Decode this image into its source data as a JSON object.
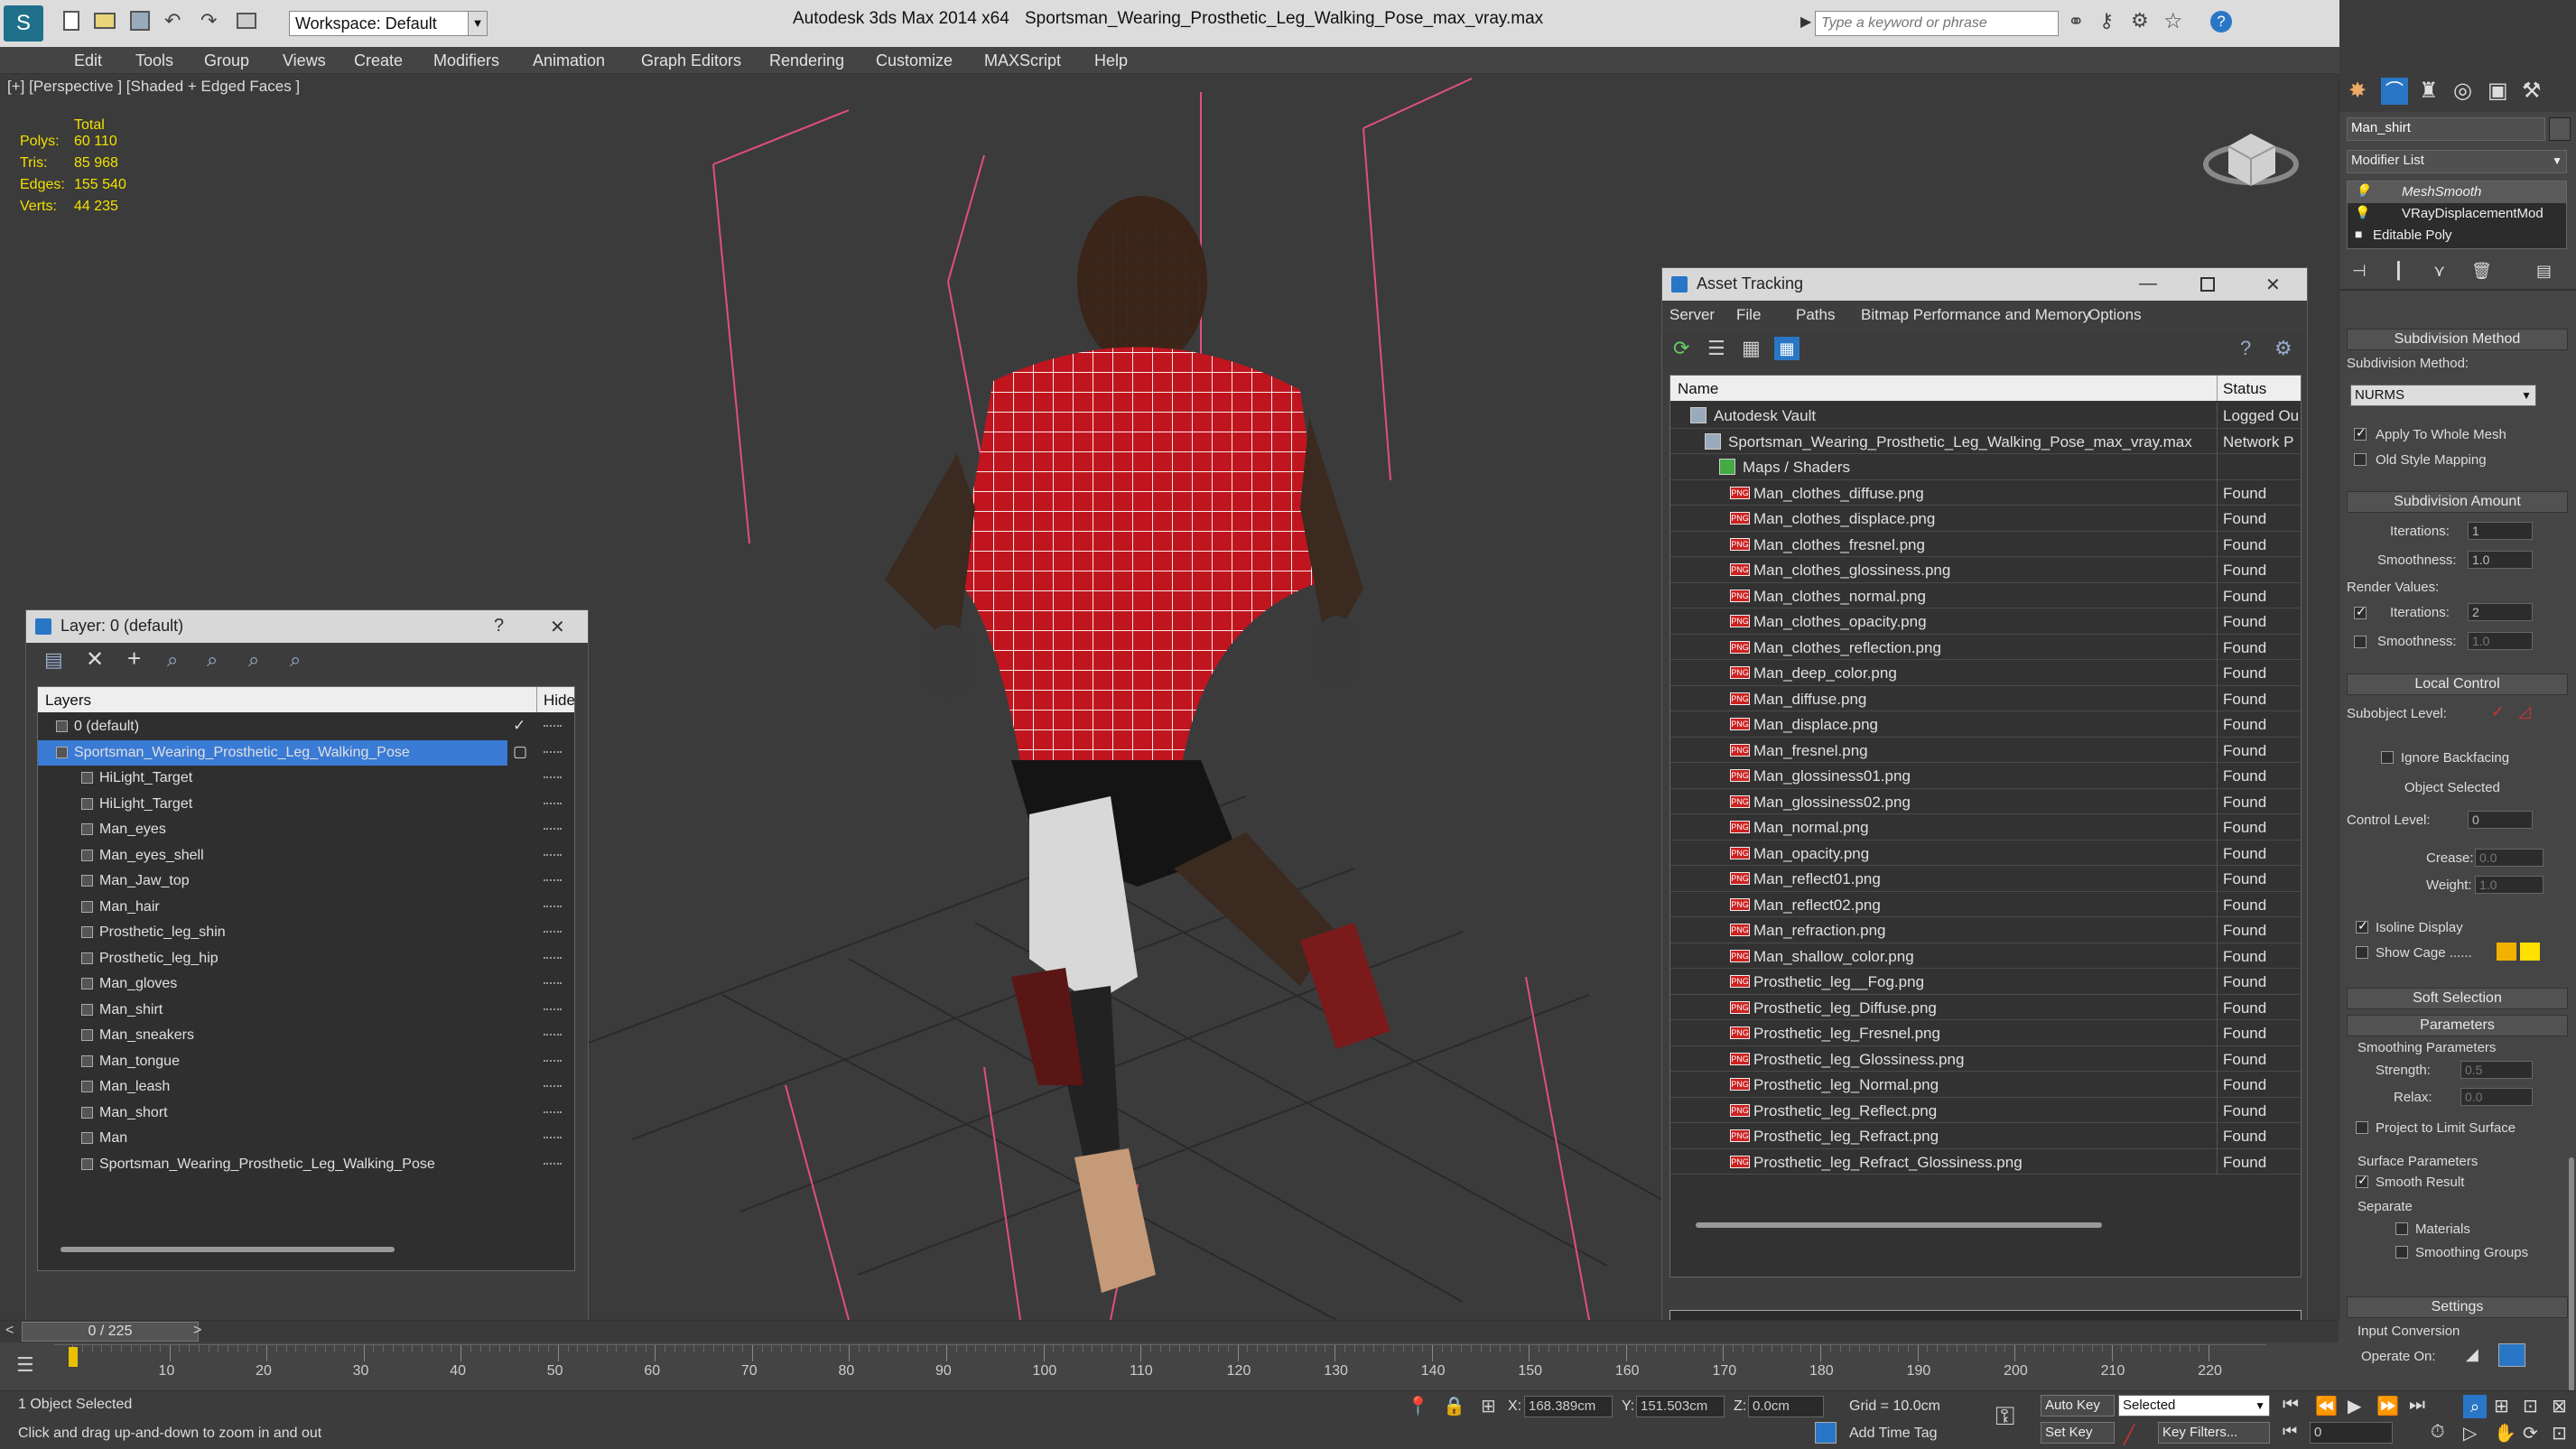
{
  "app": {
    "title_app": "Autodesk 3ds Max  2014 x64",
    "title_file": "Sportsman_Wearing_Prosthetic_Leg_Walking_Pose_max_vray.max",
    "workspace": "Workspace: Default",
    "search_placeholder": "Type a keyword or phrase"
  },
  "menu": [
    "Edit",
    "Tools",
    "Group",
    "Views",
    "Create",
    "Modifiers",
    "Animation",
    "Graph Editors",
    "Rendering",
    "Customize",
    "MAXScript",
    "Help"
  ],
  "viewport": {
    "label": "[+] [Perspective ] [Shaded + Edged Faces ]",
    "stats": {
      "header": "Total",
      "rows": [
        {
          "k": "Polys:",
          "v": "60 110"
        },
        {
          "k": "Tris:",
          "v": "85 968"
        },
        {
          "k": "Edges:",
          "v": "155 540"
        },
        {
          "k": "Verts:",
          "v": "44 235"
        }
      ]
    }
  },
  "layer_dialog": {
    "title": "Layer: 0 (default)",
    "help": "?",
    "col_layers": "Layers",
    "col_hide": "Hide",
    "rows": [
      {
        "name": "0 (default)",
        "level": 0,
        "selected": false
      },
      {
        "name": "Sportsman_Wearing_Prosthetic_Leg_Walking_Pose",
        "level": 0,
        "selected": true
      },
      {
        "name": "HiLight_Target",
        "level": 1
      },
      {
        "name": "HiLight_Target",
        "level": 1
      },
      {
        "name": "Man_eyes",
        "level": 1
      },
      {
        "name": "Man_eyes_shell",
        "level": 1
      },
      {
        "name": "Man_Jaw_top",
        "level": 1
      },
      {
        "name": "Man_hair",
        "level": 1
      },
      {
        "name": "Prosthetic_leg_shin",
        "level": 1
      },
      {
        "name": "Prosthetic_leg_hip",
        "level": 1
      },
      {
        "name": "Man_gloves",
        "level": 1
      },
      {
        "name": "Man_shirt",
        "level": 1
      },
      {
        "name": "Man_sneakers",
        "level": 1
      },
      {
        "name": "Man_tongue",
        "level": 1
      },
      {
        "name": "Man_leash",
        "level": 1
      },
      {
        "name": "Man_short",
        "level": 1
      },
      {
        "name": "Man",
        "level": 1
      },
      {
        "name": "Sportsman_Wearing_Prosthetic_Leg_Walking_Pose",
        "level": 1
      }
    ]
  },
  "asset_dialog": {
    "title": "Asset Tracking",
    "menu": [
      "Server",
      "File",
      "Paths",
      "Bitmap Performance and Memory",
      "Options"
    ],
    "col_name": "Name",
    "col_status": "Status",
    "vault": {
      "name": "Autodesk Vault",
      "status": "Logged Ou"
    },
    "file": {
      "name": "Sportsman_Wearing_Prosthetic_Leg_Walking_Pose_max_vray.max",
      "status": "Network P"
    },
    "group": {
      "name": "Maps / Shaders"
    },
    "maps": [
      "Man_clothes_diffuse.png",
      "Man_clothes_displace.png",
      "Man_clothes_fresnel.png",
      "Man_clothes_glossiness.png",
      "Man_clothes_normal.png",
      "Man_clothes_opacity.png",
      "Man_clothes_reflection.png",
      "Man_deep_color.png",
      "Man_diffuse.png",
      "Man_displace.png",
      "Man_fresnel.png",
      "Man_glossiness01.png",
      "Man_glossiness02.png",
      "Man_normal.png",
      "Man_opacity.png",
      "Man_reflect01.png",
      "Man_reflect02.png",
      "Man_refraction.png",
      "Man_shallow_color.png",
      "Prosthetic_leg__Fog.png",
      "Prosthetic_leg_Diffuse.png",
      "Prosthetic_leg_Fresnel.png",
      "Prosthetic_leg_Glossiness.png",
      "Prosthetic_leg_Normal.png",
      "Prosthetic_leg_Reflect.png",
      "Prosthetic_leg_Refract.png",
      "Prosthetic_leg_Refract_Glossiness.png"
    ],
    "found": "Found",
    "png_badge": "PNG"
  },
  "command_panel": {
    "object_name": "Man_shirt",
    "modifier_list": "Modifier List",
    "stack": [
      "MeshSmooth",
      "VRayDisplacementMod",
      "Editable Poly"
    ],
    "rollout_subdiv_method": "Subdivision Method",
    "subdiv_method_label": "Subdivision Method:",
    "subdiv_method_value": "NURMS",
    "apply_whole": "Apply To Whole Mesh",
    "old_style": "Old Style Mapping",
    "rollout_subdiv_amount": "Subdivision Amount",
    "iterations_label": "Iterations:",
    "iterations_value": "1",
    "smoothness_label": "Smoothness:",
    "smoothness_value": "1.0",
    "render_values": "Render Values:",
    "r_iterations_value": "2",
    "r_smoothness_value": "1.0",
    "rollout_local": "Local Control",
    "subobject_level": "Subobject Level:",
    "ignore_backfacing": "Ignore Backfacing",
    "object_selected": "Object Selected",
    "control_level": "Control Level:",
    "control_level_value": "0",
    "crease": "Crease:",
    "crease_value": "0.0",
    "weight": "Weight:",
    "weight_value": "1.0",
    "isoline": "Isoline Display",
    "show_cage": "Show Cage ......",
    "rollout_soft": "Soft Selection",
    "rollout_params": "Parameters",
    "smoothing_params": "Smoothing Parameters",
    "strength": "Strength:",
    "strength_value": "0.5",
    "relax": "Relax:",
    "relax_value": "0.0",
    "project_limit": "Project to Limit Surface",
    "surface_params": "Surface Parameters",
    "smooth_result": "Smooth Result",
    "separate": "Separate",
    "materials": "Materials",
    "smoothing_groups": "Smoothing Groups",
    "rollout_settings": "Settings",
    "input_conversion": "Input Conversion",
    "operate_on": "Operate On:"
  },
  "timeline": {
    "frame": "0 / 225",
    "ticks": [
      "0",
      "10",
      "20",
      "30",
      "40",
      "50",
      "60",
      "70",
      "80",
      "90",
      "100",
      "110",
      "120",
      "130",
      "140",
      "150",
      "160",
      "170",
      "180",
      "190",
      "200",
      "210",
      "220"
    ]
  },
  "status": {
    "selected": "1 Object Selected",
    "hint": "Click and drag up-and-down to zoom in and out",
    "x_label": "X:",
    "x_value": "168.389cm",
    "y_label": "Y:",
    "y_value": "151.503cm",
    "z_label": "Z:",
    "z_value": "0.0cm",
    "grid": "Grid = 10.0cm",
    "add_time_tag": "Add Time Tag",
    "auto_key": "Auto Key",
    "set_key": "Set Key",
    "selected_dropdown": "Selected",
    "key_filters": "Key Filters...",
    "frame_value": "0"
  },
  "colors": {
    "accent": "#2a76c6",
    "stats": "#f2e000",
    "selection": "#3a7bd5"
  }
}
